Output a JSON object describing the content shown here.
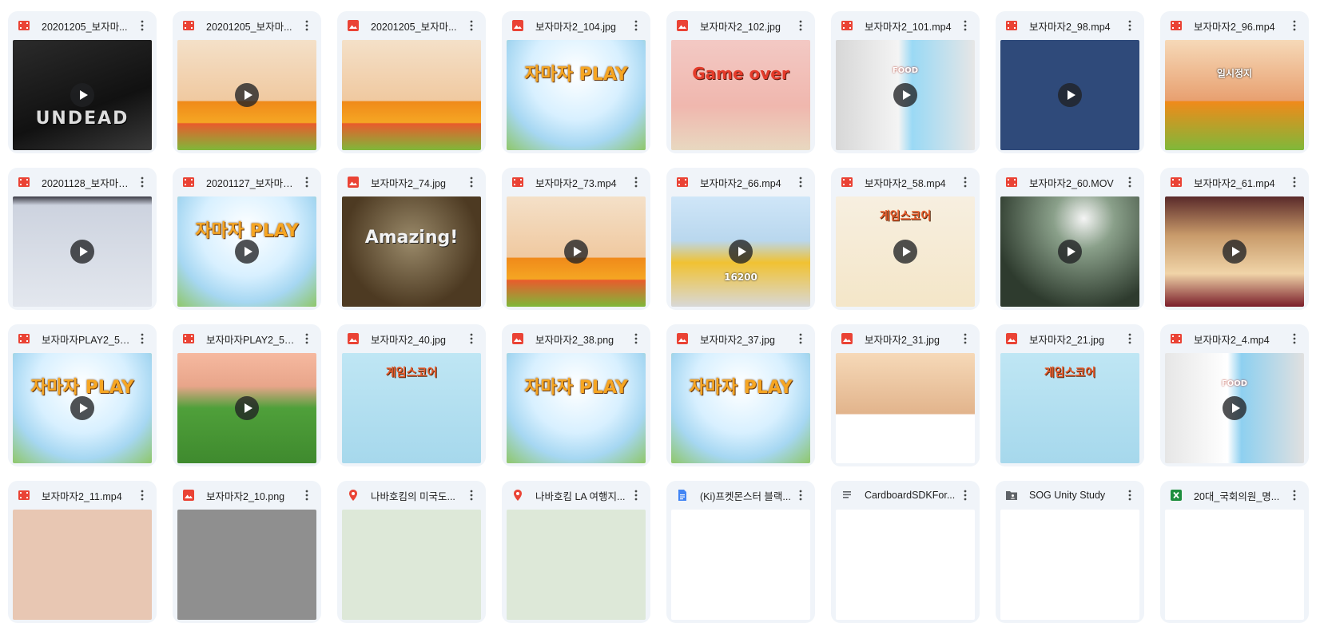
{
  "colors": {
    "card_bg": "#f0f4f9",
    "video_icon": "#ea4335",
    "image_icon": "#ea4335",
    "maps_icon": "#ea4335",
    "doc_icon": "#4285f4",
    "text_icon": "#5f6368",
    "folder_icon": "#5f6368",
    "sheets_icon": "#1e8e3e"
  },
  "files": [
    {
      "name": "20201205_보자마...",
      "type": "video",
      "icon": "video-icon",
      "thumb": "t-dark",
      "thumb_text": "UNDEAD",
      "play": true
    },
    {
      "name": "20201205_보자마...",
      "type": "video",
      "icon": "video-icon",
      "thumb": "t-sandwich",
      "thumb_text": "",
      "play": true
    },
    {
      "name": "20201205_보자마...",
      "type": "image",
      "icon": "image-icon",
      "thumb": "t-sandwich",
      "thumb_text": "",
      "play": false
    },
    {
      "name": "보자마자2_104.jpg",
      "type": "image",
      "icon": "image-icon",
      "thumb": "t-logo",
      "thumb_text": "자마자 PLAY",
      "play": false
    },
    {
      "name": "보자마자2_102.jpg",
      "type": "image",
      "icon": "image-icon",
      "thumb": "t-failure",
      "thumb_text": "Game over",
      "play": false
    },
    {
      "name": "보자마자2_101.mp4",
      "type": "video",
      "icon": "video-icon",
      "thumb": "t-food",
      "thumb_text": "FOOD",
      "play": true
    },
    {
      "name": "보자마자2_98.mp4",
      "type": "video",
      "icon": "video-icon",
      "thumb": "t-blue",
      "thumb_text": "",
      "play": true
    },
    {
      "name": "보자마자2_96.mp4",
      "type": "video",
      "icon": "video-icon",
      "thumb": "t-pause",
      "thumb_text": "일시정지",
      "play": false
    },
    {
      "name": "20201128_보자마자...",
      "type": "video",
      "icon": "video-icon",
      "thumb": "t-tablet",
      "thumb_text": "",
      "play": true
    },
    {
      "name": "20201127_보자마자...",
      "type": "video",
      "icon": "video-icon",
      "thumb": "t-logo",
      "thumb_text": "자마자 PLAY",
      "play": true
    },
    {
      "name": "보자마자2_74.jpg",
      "type": "image",
      "icon": "image-icon",
      "thumb": "t-amazing",
      "thumb_text": "Amazing!",
      "play": false
    },
    {
      "name": "보자마자2_73.mp4",
      "type": "video",
      "icon": "video-icon",
      "thumb": "t-sandwich",
      "thumb_text": "",
      "play": true
    },
    {
      "name": "보자마자2_66.mp4",
      "type": "video",
      "icon": "video-icon",
      "thumb": "t-bus",
      "thumb_text": "16200",
      "play": true
    },
    {
      "name": "보자마자2_58.mp4",
      "type": "video",
      "icon": "video-icon",
      "thumb": "t-score",
      "thumb_text": "게임스코어",
      "play": true
    },
    {
      "name": "보자마자2_60.MOV",
      "type": "video",
      "icon": "video-icon",
      "thumb": "t-metal",
      "thumb_text": "",
      "play": true
    },
    {
      "name": "보자마자2_61.mp4",
      "type": "video",
      "icon": "video-icon",
      "thumb": "t-bowling",
      "thumb_text": "",
      "play": true
    },
    {
      "name": "보자마자PLAY2_54....",
      "type": "video",
      "icon": "video-icon",
      "thumb": "t-logo",
      "thumb_text": "자마자 PLAY",
      "play": true
    },
    {
      "name": "보자마자PLAY2_53....",
      "type": "video",
      "icon": "video-icon",
      "thumb": "t-soccer",
      "thumb_text": "",
      "play": true
    },
    {
      "name": "보자마자2_40.jpg",
      "type": "image",
      "icon": "image-icon",
      "thumb": "t-score2",
      "thumb_text": "게임스코어",
      "play": false
    },
    {
      "name": "보자마자2_38.png",
      "type": "image",
      "icon": "image-icon",
      "thumb": "t-logo",
      "thumb_text": "자마자 PLAY",
      "play": false
    },
    {
      "name": "보자마자2_37.jpg",
      "type": "image",
      "icon": "image-icon",
      "thumb": "t-logo",
      "thumb_text": "자마자 PLAY",
      "play": false
    },
    {
      "name": "보자마자2_31.jpg",
      "type": "image",
      "icon": "image-icon",
      "thumb": "t-doc",
      "thumb_text": "",
      "play": false
    },
    {
      "name": "보자마자2_21.jpg",
      "type": "image",
      "icon": "image-icon",
      "thumb": "t-score2",
      "thumb_text": "게임스코어",
      "play": false
    },
    {
      "name": "보자마자2_4.mp4",
      "type": "video",
      "icon": "video-icon",
      "thumb": "t-food2",
      "thumb_text": "FOOD",
      "play": true
    },
    {
      "name": "보자마자2_11.mp4",
      "type": "video",
      "icon": "video-icon",
      "thumb": "t-peach",
      "thumb_text": "",
      "play": false
    },
    {
      "name": "보자마자2_10.png",
      "type": "image",
      "icon": "image-icon",
      "thumb": "t-greyish",
      "thumb_text": "",
      "play": false
    },
    {
      "name": "나바호킴의 미국도...",
      "type": "maps",
      "icon": "map-pin-icon",
      "thumb": "t-map",
      "thumb_text": "",
      "play": false
    },
    {
      "name": "나바호킴 LA 여행지...",
      "type": "maps",
      "icon": "map-pin-icon",
      "thumb": "t-map",
      "thumb_text": "",
      "play": false
    },
    {
      "name": "(Ki)프켓몬스터 블랙...",
      "type": "doc",
      "icon": "doc-icon",
      "thumb": "t-plain",
      "thumb_text": "",
      "play": false
    },
    {
      "name": "CardboardSDKFor...",
      "type": "text",
      "icon": "text-file-icon",
      "thumb": "t-plain",
      "thumb_text": "",
      "play": false
    },
    {
      "name": "SOG Unity Study",
      "type": "folder",
      "icon": "shared-folder-icon",
      "thumb": "t-plain",
      "thumb_text": "",
      "play": false
    },
    {
      "name": "20대_국회의원_명...",
      "type": "sheet",
      "icon": "sheets-icon",
      "thumb": "t-plain",
      "thumb_text": "",
      "play": false
    }
  ]
}
